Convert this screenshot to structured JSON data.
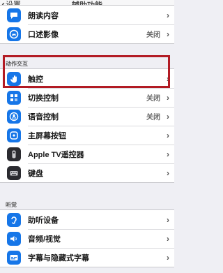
{
  "nav": {
    "back_label": "设置",
    "title": "辅助功能"
  },
  "colors": {
    "icon_blue": "#1676e8",
    "icon_dark": "#2b2b30",
    "highlight": "#b21b24"
  },
  "group_top": {
    "rows": [
      {
        "label": "朗读内容",
        "icon": "speech-bubble-icon",
        "chevron": true
      },
      {
        "label": "口述影像",
        "icon": "description-icon",
        "value": "关闭",
        "chevron": true
      }
    ]
  },
  "section_interaction": {
    "header": "动作交互",
    "rows": [
      {
        "label": "触控",
        "icon": "hand-touch-icon",
        "chevron": true
      },
      {
        "label": "切换控制",
        "icon": "switch-grid-icon",
        "value": "关闭",
        "chevron": true
      },
      {
        "label": "语音控制",
        "icon": "voice-control-icon",
        "value": "关闭",
        "chevron": true
      },
      {
        "label": "主屏幕按钮",
        "icon": "home-button-icon",
        "chevron": true
      },
      {
        "label": "Apple TV遥控器",
        "icon": "tv-remote-icon",
        "chevron": true
      },
      {
        "label": "键盘",
        "icon": "keyboard-icon",
        "chevron": true
      }
    ]
  },
  "section_hearing": {
    "header": "听觉",
    "rows": [
      {
        "label": "助听设备",
        "icon": "ear-icon",
        "chevron": true
      },
      {
        "label": "音频/视觉",
        "icon": "audio-visual-icon",
        "chevron": true
      },
      {
        "label": "字幕与隐藏式字幕",
        "icon": "captions-icon",
        "chevron": true
      }
    ]
  }
}
